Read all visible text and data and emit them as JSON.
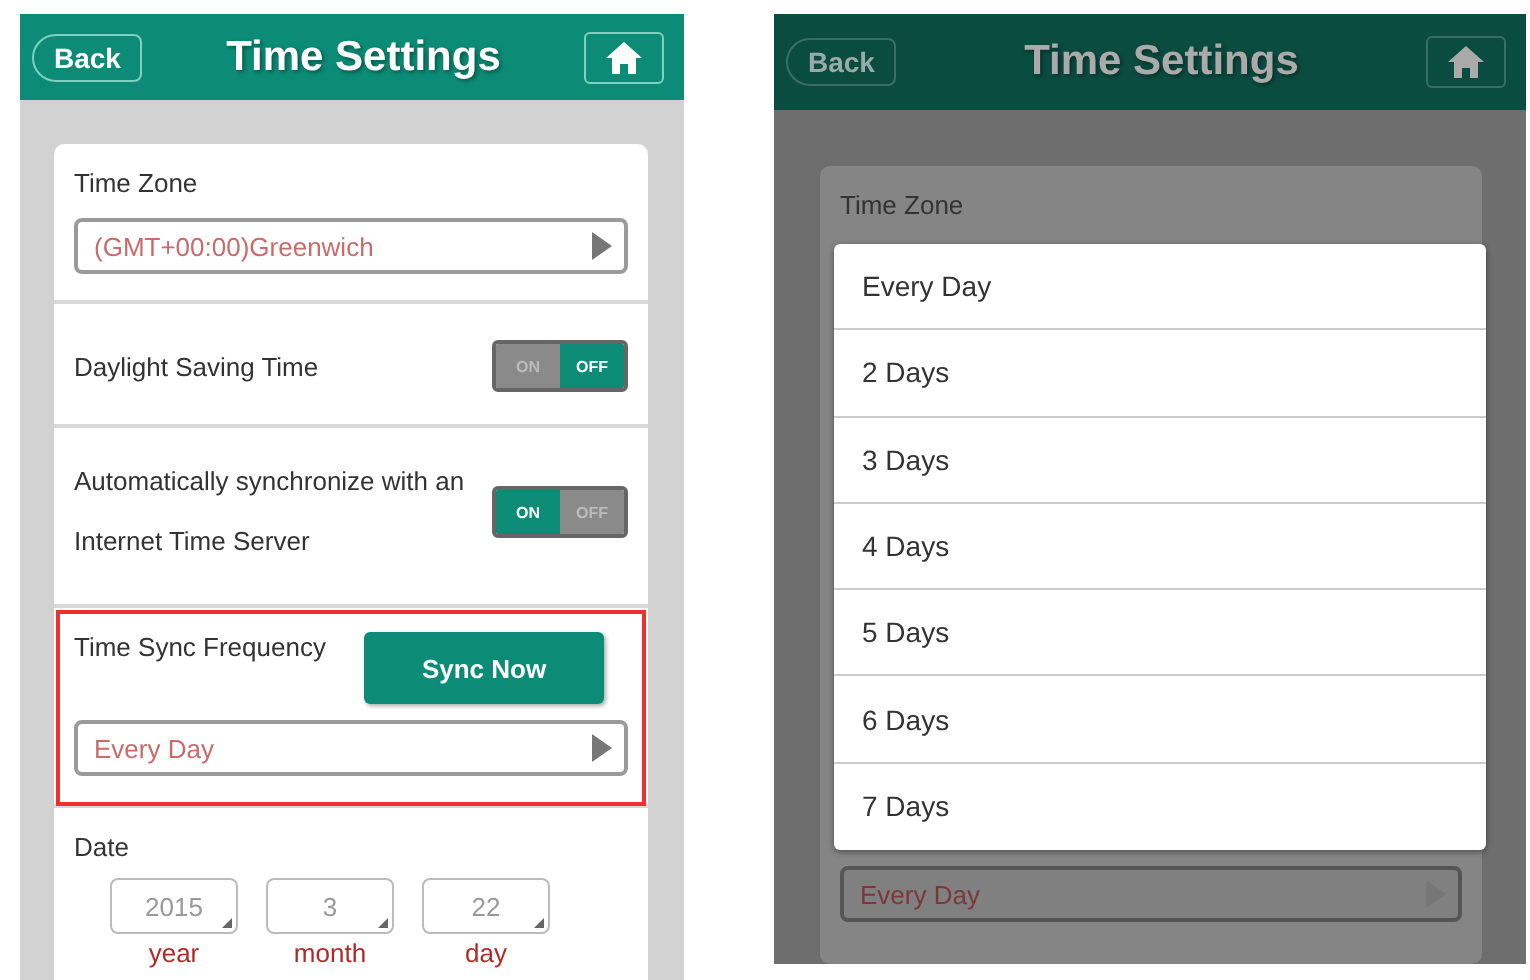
{
  "left_screen": {
    "header": {
      "back": "Back",
      "title": "Time Settings"
    },
    "time_zone": {
      "label": "Time Zone",
      "value": "(GMT+00:00)Greenwich"
    },
    "toggles": [
      {
        "label": "Daylight Saving Time",
        "on": false,
        "on_text": "ON",
        "off_text": "OFF"
      },
      {
        "label": "Automatically synchronize with an Internet Time Server",
        "on": true,
        "on_text": "ON",
        "off_text": "OFF"
      }
    ],
    "sync": {
      "label": "Time Sync Frequency",
      "button": "Sync Now",
      "value": "Every Day",
      "highlighted": true
    },
    "date": {
      "label": "Date",
      "fields": [
        {
          "value": "2015",
          "caption": "year"
        },
        {
          "value": "3",
          "caption": "month"
        },
        {
          "value": "22",
          "caption": "day"
        }
      ]
    }
  },
  "right_screen": {
    "header": {
      "back": "Back",
      "title": "Time Settings"
    },
    "time_zone_label": "Time Zone",
    "options": [
      "Every Day",
      "2 Days",
      "3 Days",
      "4 Days",
      "5 Days",
      "6 Days",
      "7 Days"
    ],
    "frequency_value": "Every Day"
  }
}
